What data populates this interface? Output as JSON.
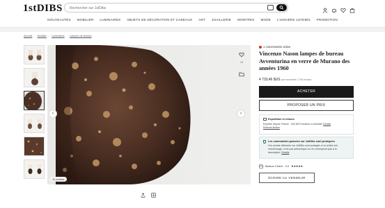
{
  "header": {
    "logo": "1stDIBS",
    "search_placeholder": "Rechercher sur 1stDibs",
    "nav": [
      "NOUVEAUTÉS",
      "MOBILIER",
      "LUMINAIRES",
      "OBJETS DE DÉCORATION ET CADEAUX",
      "ART",
      "JOAILLERIE",
      "MONTRES",
      "MODE",
      "L'UNIVERS 1STDIBS",
      "PROMOTION"
    ]
  },
  "breadcrumb": {
    "items": [
      "Accueil",
      "Mobilier",
      "Luminaires",
      "Lampes de bureau"
    ]
  },
  "gallery": {
    "photo_count": "11 photos",
    "favorite_count": "15"
  },
  "product": {
    "conversation": "1 conversation active",
    "title": "Vincenzo Nason lampes de bureau Avventurina en verre de Murano des années 1960",
    "price": "4 733,46 $US",
    "price_note": "par ensemble | TVA incluse",
    "buy_label": "ACHETER",
    "offer_label": "PROPOSER UN PRIX",
    "shipping_title": "Expédition et retours",
    "shipping_line1": "Expédié depuis France : 340 $US livraison à domicile",
    "shipping_details_link": "Détails",
    "shipping_line2": "Retours limités",
    "protection_title": "Les commandes passées sur 1stDibs sont protégées",
    "protection_text": "Vos achats effectués sur 1stDibs sont protégés si un article est endommagé, n'est pas authentique ou ne correspond pas à la description.",
    "protection_link": "Détails",
    "seller_label": "Maison Cedric",
    "seller_rating": "5.0",
    "seller_stars": "★★★★★",
    "write_label": "ÉCRIRE AU VENDEUR"
  },
  "colors": {
    "buy_button": "#1a1a1a",
    "protection_bg": "#eef4f3",
    "conversation_dot": "#c0392b"
  }
}
